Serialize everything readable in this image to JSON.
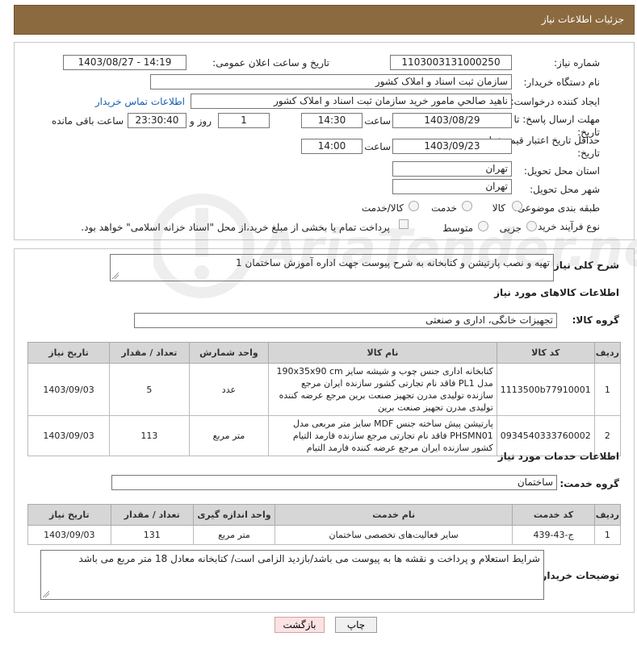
{
  "header": {
    "title": "جزئیات اطلاعات نیاز"
  },
  "form": {
    "need_number_label": "شماره نیاز:",
    "need_number": "1103003131000250",
    "announce_label": "تاریخ و ساعت اعلان عمومی:",
    "announce_value": "1403/08/27 - 14:19",
    "buyer_org_label": "نام دستگاه خریدار:",
    "buyer_org": "سازمان ثبت اسناد و املاک کشور",
    "requester_label": "ایجاد کننده درخواست:",
    "requester": "ناهید صالحي مامور خرید سازمان ثبت اسناد و املاک کشور",
    "contact_link": "اطلاعات تماس خریدار",
    "deadline_label_1": "مهلت ارسال پاسخ: تا",
    "deadline_label_2": "تاریخ:",
    "deadline_date": "1403/08/29",
    "hour_label": "ساعت",
    "deadline_time": "14:30",
    "days_value": "1",
    "days_label": "روز و",
    "remaining_time": "23:30:40",
    "remaining_label": "ساعت باقی مانده",
    "validity_label_1": "حداقل تاریخ اعتبار قیمت: تا",
    "validity_label_2": "تاریخ:",
    "validity_date": "1403/09/23",
    "validity_time": "14:00",
    "province_label": "استان محل تحویل:",
    "province": "تهران",
    "city_label": "شهر محل تحویل:",
    "city": "تهران",
    "category_label": "طبقه بندی موضوعی:",
    "category_options": [
      "کالا",
      "خدمت",
      "کالا/خدمت"
    ],
    "process_label": "نوع فرآیند خرید :",
    "process_options": [
      "جزیی",
      "متوسط"
    ],
    "payment_note": "پرداخت تمام یا بخشی از مبلغ خرید،از محل \"اسناد خزانه اسلامی\" خواهد بود."
  },
  "general_desc": {
    "label": "شرح کلی نیاز:",
    "value": "تهیه و نصب پارتیشن و کتابخانه به شرح پیوست جهت اداره آموزش ساختمان 1"
  },
  "goods": {
    "section_title": "اطلاعات کالاهای مورد نیاز",
    "group_label": "گروه کالا:",
    "group_value": "تجهیزات خانگی، اداری و صنعتی",
    "columns": [
      "ردیف",
      "کد کالا",
      "نام کالا",
      "واحد شمارش",
      "تعداد / مقدار",
      "تاریخ نیاز"
    ],
    "rows": [
      {
        "index": "1",
        "code": "1113500b77910001",
        "name": "کتابخانه اداری جنس چوب و شیشه سایز 190x35x90 cm مدل PL1 فاقد نام تجارتی کشور سازنده ایران مرجع سازنده تولیدی مدرن تجهیز صنعت برین مرجع عرضه کننده تولیدی مدرن تجهیز صنعت برین",
        "unit": "عدد",
        "qty": "5",
        "date": "1403/09/03"
      },
      {
        "index": "2",
        "code": "0934540333760002",
        "name": "پارتیشن پیش ساخته جنس MDF سایز متر مربعی مدل PHSMN01 فاقد نام تجارتی مرجع سازنده فارمد التیام کشور سازنده ایران مرجع عرضه کننده فارمد التیام",
        "unit": "متر مربع",
        "qty": "113",
        "date": "1403/09/03"
      }
    ]
  },
  "services": {
    "section_title": "اطلاعات خدمات مورد نیاز",
    "group_label": "گروه خدمت:",
    "group_value": "ساختمان",
    "columns": [
      "ردیف",
      "کد خدمت",
      "نام خدمت",
      "واحد اندازه گیری",
      "تعداد / مقدار",
      "تاریخ نیاز"
    ],
    "rows": [
      {
        "index": "1",
        "code": "ج-43-439",
        "name": "سایر فعالیت‌های تخصصی ساختمان",
        "unit": "متر مربع",
        "qty": "131",
        "date": "1403/09/03"
      }
    ]
  },
  "buyer_notes": {
    "label": "توضیحات خریدار:",
    "value": "شرایط استعلام و پرداخت و نقشه ها به پیوست می باشد/بازدید الزامی است/ کتابخانه معادل 18 متر مربع می باشد"
  },
  "actions": {
    "print": "چاپ",
    "back": "بازگشت"
  },
  "watermark": {
    "brand": "AriaTender.net"
  },
  "colors": {
    "header_bg": "#8c6a3f",
    "link": "#1a5fb4",
    "table_header": "#d6d6d6"
  }
}
